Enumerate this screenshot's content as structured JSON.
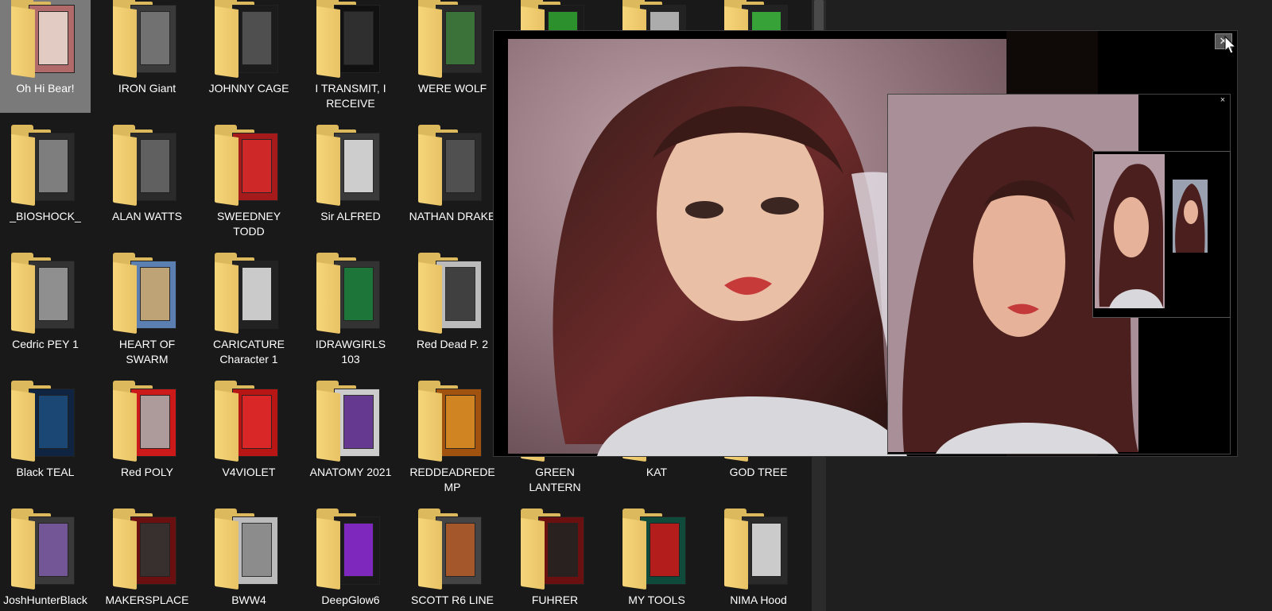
{
  "explorer": {
    "folders": [
      {
        "label": "Oh Hi Bear!",
        "selected": true,
        "preview": [
          "#b06a6a",
          "#e8d6cc"
        ]
      },
      {
        "label": "IRON Giant",
        "preview": [
          "#3a3a3a",
          "#777"
        ]
      },
      {
        "label": "JOHNNY CAGE",
        "preview": [
          "#1b1b1b",
          "#555"
        ]
      },
      {
        "label": "I TRANSMIT, I\nRECEIVE",
        "preview": [
          "#111",
          "#333"
        ]
      },
      {
        "label": "WERE WOLF",
        "preview": [
          "#2a2a2a",
          "#3c7a3c"
        ]
      },
      {
        "label": "",
        "preview": [
          "#1a1a1a",
          "#2e9e2e"
        ]
      },
      {
        "label": "",
        "preview": [
          "#222",
          "#bbb"
        ]
      },
      {
        "label": "",
        "preview": [
          "#222",
          "#3ab03a"
        ]
      },
      {
        "label": "_BIOSHOCK_",
        "preview": [
          "#2a2a2a",
          "#888"
        ]
      },
      {
        "label": "ALAN WATTS",
        "preview": [
          "#2b2b2b",
          "#666"
        ]
      },
      {
        "label": "SWEEDNEY\nTODD",
        "preview": [
          "#a51a1a",
          "#d42a2a"
        ]
      },
      {
        "label": "Sir ALFRED",
        "preview": [
          "#3a3a3a",
          "#ddd"
        ]
      },
      {
        "label": "NATHAN DRAKE",
        "preview": [
          "#2a2a2a",
          "#555"
        ]
      },
      {
        "label": "Cedric PEY 1",
        "preview": [
          "#333",
          "#999"
        ]
      },
      {
        "label": "HEART OF\nSWARM",
        "preview": [
          "#5a7fb0",
          "#c8a770"
        ]
      },
      {
        "label": "CARICATURE\nCharacter 1",
        "preview": [
          "#222",
          "#ddd"
        ]
      },
      {
        "label": "IDRAWGIRLS 103",
        "preview": [
          "#333",
          "#1b7d3a"
        ]
      },
      {
        "label": "Red Dead P. 2",
        "preview": [
          "#bbb",
          "#333"
        ]
      },
      {
        "label": "Black TEAL",
        "preview": [
          "#0f2440",
          "#1d4b7a"
        ]
      },
      {
        "label": "Red POLY",
        "preview": [
          "#cc1a1a",
          "#aaa"
        ]
      },
      {
        "label": "V4VIOLET",
        "preview": [
          "#b81515",
          "#dd2a2a"
        ]
      },
      {
        "label": "ANATOMY 2021",
        "preview": [
          "#ccc",
          "#5a2a8a"
        ]
      },
      {
        "label": "REDDEADREDE\nMP",
        "preview": [
          "#a0520e",
          "#d68a25"
        ]
      },
      {
        "label": "GREEN LANTERN",
        "preview": [
          "#1a1a1a",
          "#333"
        ]
      },
      {
        "label": "KAT",
        "preview": [
          "#1a1a1a",
          "#333"
        ]
      },
      {
        "label": "GOD TREE",
        "preview": [
          "#1a1a1a",
          "#333"
        ]
      },
      {
        "label": "JoshHunterBlack",
        "preview": [
          "#3a3a3a",
          "#7a5aa0"
        ]
      },
      {
        "label": "MAKERSPLACE",
        "preview": [
          "#6a1010",
          "#333"
        ]
      },
      {
        "label": "BWW4",
        "preview": [
          "#bbb",
          "#888"
        ]
      },
      {
        "label": "DeepGlow6",
        "preview": [
          "#1a1a1a",
          "#8a2ad0"
        ]
      },
      {
        "label": "SCOTT R6 LINE",
        "preview": [
          "#444",
          "#b05a2a"
        ]
      },
      {
        "label": "FUHRER CATSLE",
        "preview": [
          "#6a1010",
          "#222"
        ]
      },
      {
        "label": "MY TOOLS",
        "preview": [
          "#0f4a3a",
          "#c51a1a"
        ]
      },
      {
        "label": "NIMA Hood",
        "preview": [
          "#2a2a2a",
          "#ddd"
        ]
      }
    ]
  },
  "viewer_main": {
    "close_label": "✕"
  },
  "viewer_second": {
    "close_label": "×"
  },
  "icons": {
    "close": "close-icon",
    "cursor": "mouse-pointer-icon",
    "folder": "folder-icon"
  },
  "colors": {
    "background": "#191919",
    "folder": "#dcb95c",
    "selected": "#7a7a7a"
  }
}
